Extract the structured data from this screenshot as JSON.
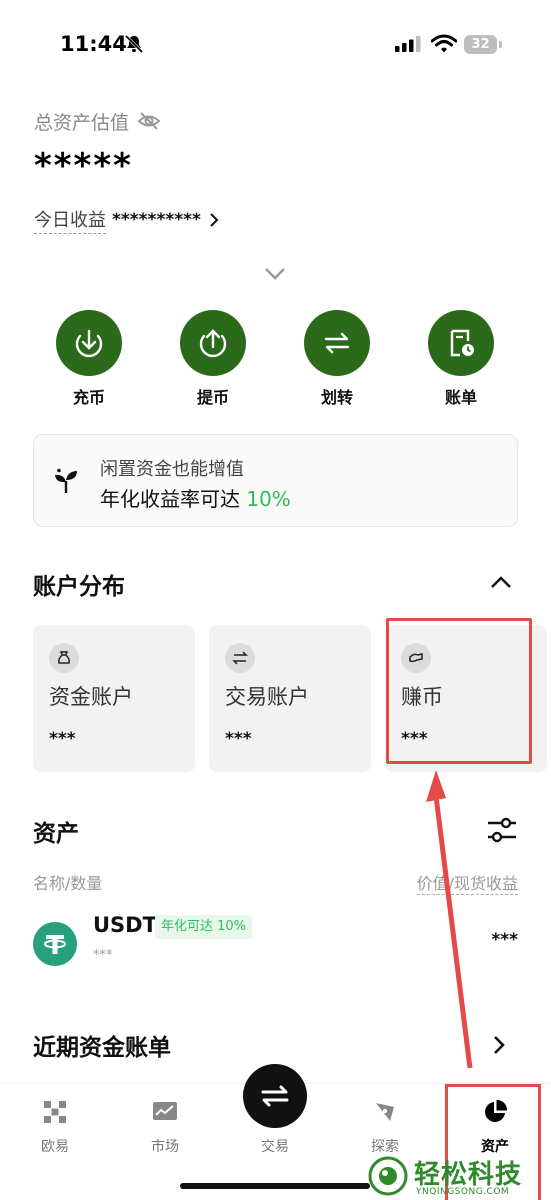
{
  "status_bar": {
    "time": "11:44",
    "battery": "32"
  },
  "header": {
    "total_label": "总资产估值",
    "total_value": "*****",
    "today_label": "今日收益",
    "today_value": "**********"
  },
  "actions": [
    {
      "label": "充币",
      "icon": "deposit-icon"
    },
    {
      "label": "提币",
      "icon": "withdraw-icon"
    },
    {
      "label": "划转",
      "icon": "transfer-icon"
    },
    {
      "label": "账单",
      "icon": "bill-icon"
    }
  ],
  "promo": {
    "line1": "闲置资金也能增值",
    "line2_prefix": "年化收益率可达 ",
    "rate": "10%"
  },
  "distribution": {
    "title": "账户分布",
    "cards": [
      {
        "name": "资金账户",
        "value": "***",
        "icon": "money-bag-icon"
      },
      {
        "name": "交易账户",
        "value": "***",
        "icon": "swap-icon"
      },
      {
        "name": "赚币",
        "value": "***",
        "icon": "earn-icon"
      }
    ]
  },
  "assets": {
    "title": "资产",
    "col_left": "名称/数量",
    "col_right": "价值/现货收益",
    "rows": [
      {
        "name": "USDT",
        "badge": "年化可达 10%",
        "sub": "***",
        "value": "***"
      }
    ]
  },
  "bills": {
    "title": "近期资金账单"
  },
  "nav": [
    {
      "label": "欧易"
    },
    {
      "label": "市场"
    },
    {
      "label": "交易"
    },
    {
      "label": "探索"
    },
    {
      "label": "资产"
    }
  ],
  "watermark": {
    "text": "轻松科技",
    "sub": "YNQINGSONG.COM"
  },
  "colors": {
    "accent": "#2c6a1b",
    "positive": "#2dbe59",
    "annotation": "#e44a48"
  }
}
